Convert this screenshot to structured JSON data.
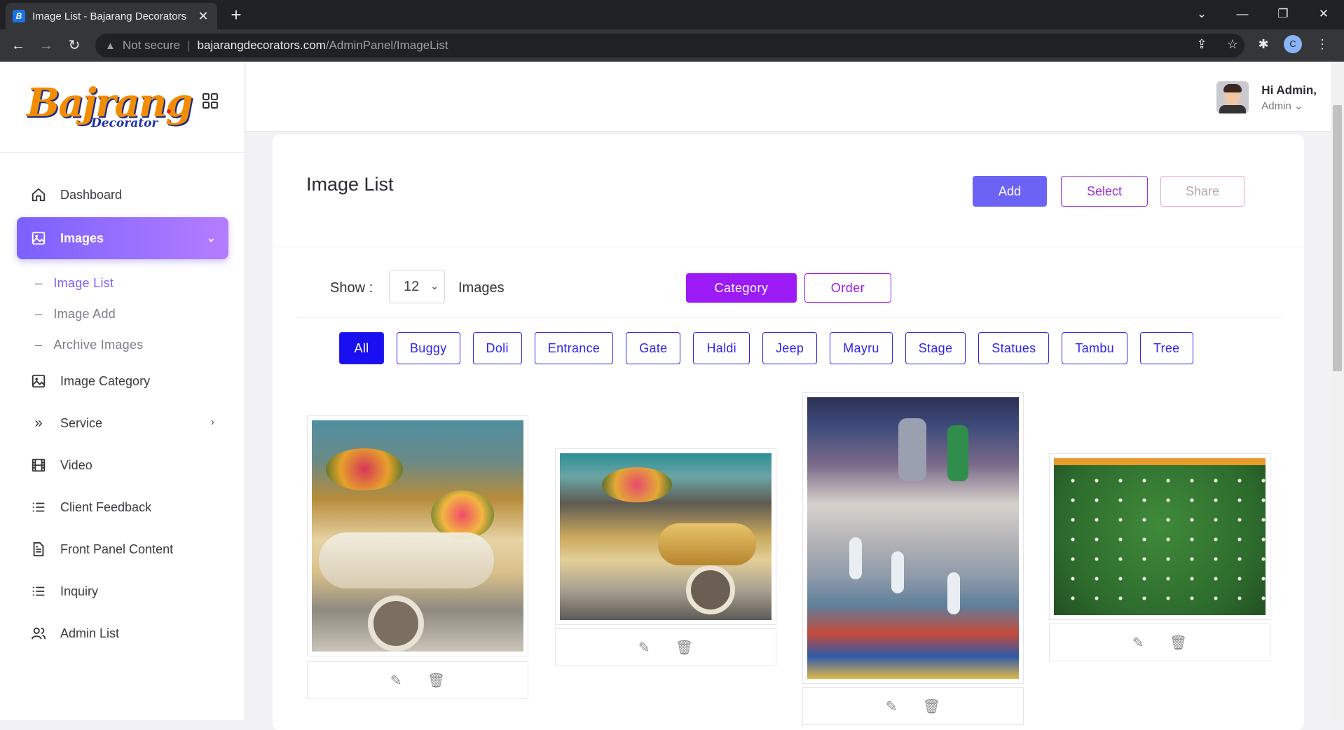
{
  "browser": {
    "tab_title": "Image List - Bajarang Decorators",
    "favicon_letter": "B",
    "security_label": "Not secure",
    "url_host": "bajarangdecorators.com",
    "url_path": "/AdminPanel/ImageList",
    "profile_initial": "C"
  },
  "brand": {
    "logo_main": "Bajrang",
    "logo_sub": "Decorator"
  },
  "sidebar": {
    "items": [
      {
        "label": "Dashboard",
        "icon": "home-icon"
      },
      {
        "label": "Images",
        "icon": "image-icon",
        "active": true
      },
      {
        "label": "Image Category",
        "icon": "image-icon"
      },
      {
        "label": "Service",
        "icon": "double-chevron-icon"
      },
      {
        "label": "Video",
        "icon": "film-icon"
      },
      {
        "label": "Client Feedback",
        "icon": "list-icon"
      },
      {
        "label": "Front Panel Content",
        "icon": "document-icon"
      },
      {
        "label": "Inquiry",
        "icon": "list-icon"
      },
      {
        "label": "Admin List",
        "icon": "users-icon"
      }
    ],
    "sub_items": [
      {
        "label": "Image List",
        "active": true
      },
      {
        "label": "Image Add"
      },
      {
        "label": "Archive Images"
      }
    ]
  },
  "user": {
    "greeting": "Hi Admin,",
    "role": "Admin"
  },
  "page": {
    "title": "Image List",
    "add_label": "Add",
    "select_label": "Select",
    "share_label": "Share",
    "show_label": "Show :",
    "show_value": "12",
    "images_label": "Images",
    "category_label": "Category",
    "order_label": "Order"
  },
  "filters": [
    "All",
    "Buggy",
    "Doli",
    "Entrance",
    "Gate",
    "Haldi",
    "Jeep",
    "Mayru",
    "Stage",
    "Statues",
    "Tambu",
    "Tree"
  ],
  "active_filter": "All",
  "colors": {
    "accent": "#6c63f5",
    "purple": "#9b1af5",
    "filter_blue": "#2d25f0"
  }
}
